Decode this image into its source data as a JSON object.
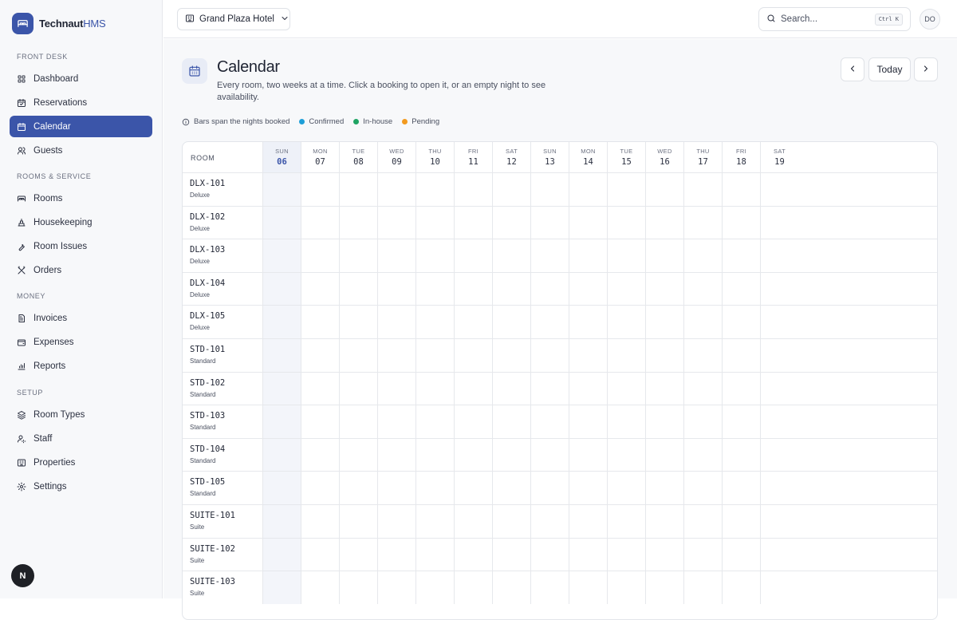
{
  "brand": {
    "name": "Technaut",
    "suffix": "HMS"
  },
  "sidebar": {
    "sections": [
      {
        "label": "FRONT DESK",
        "items": [
          {
            "label": "Dashboard",
            "icon": "grid-icon"
          },
          {
            "label": "Reservations",
            "icon": "calendar-check-icon"
          },
          {
            "label": "Calendar",
            "icon": "calendar-icon",
            "active": true
          },
          {
            "label": "Guests",
            "icon": "users-icon"
          }
        ]
      },
      {
        "label": "ROOMS & SERVICE",
        "items": [
          {
            "label": "Rooms",
            "icon": "bed-icon"
          },
          {
            "label": "Housekeeping",
            "icon": "brush-icon"
          },
          {
            "label": "Room Issues",
            "icon": "wrench-icon"
          },
          {
            "label": "Orders",
            "icon": "utensils-icon"
          }
        ]
      },
      {
        "label": "MONEY",
        "items": [
          {
            "label": "Invoices",
            "icon": "file-icon"
          },
          {
            "label": "Expenses",
            "icon": "wallet-icon"
          },
          {
            "label": "Reports",
            "icon": "bar-chart-icon"
          }
        ]
      },
      {
        "label": "SETUP",
        "items": [
          {
            "label": "Room Types",
            "icon": "layers-icon"
          },
          {
            "label": "Staff",
            "icon": "user-cog-icon"
          },
          {
            "label": "Properties",
            "icon": "building-icon"
          },
          {
            "label": "Settings",
            "icon": "gear-icon"
          }
        ]
      }
    ],
    "bottom_avatar": "N"
  },
  "topbar": {
    "hotel": "Grand Plaza Hotel",
    "search_placeholder": "Search...",
    "search_shortcut": "Ctrl K",
    "user_initials": "DO"
  },
  "page": {
    "title": "Calendar",
    "subtitle": "Every room, two weeks at a time. Click a booking to open it, or an empty night to see availability.",
    "today_label": "Today"
  },
  "legend": {
    "info": "Bars span the nights booked",
    "items": [
      {
        "label": "Confirmed",
        "color": "#1e9fd8"
      },
      {
        "label": "In-house",
        "color": "#1fa463"
      },
      {
        "label": "Pending",
        "color": "#f29a1f"
      }
    ]
  },
  "calendar": {
    "room_header": "ROOM",
    "days": [
      {
        "name": "SUN",
        "date": "06",
        "today": true
      },
      {
        "name": "MON",
        "date": "07"
      },
      {
        "name": "TUE",
        "date": "08"
      },
      {
        "name": "WED",
        "date": "09"
      },
      {
        "name": "THU",
        "date": "10"
      },
      {
        "name": "FRI",
        "date": "11"
      },
      {
        "name": "SAT",
        "date": "12"
      },
      {
        "name": "SUN",
        "date": "13"
      },
      {
        "name": "MON",
        "date": "14"
      },
      {
        "name": "TUE",
        "date": "15"
      },
      {
        "name": "WED",
        "date": "16"
      },
      {
        "name": "THU",
        "date": "17"
      },
      {
        "name": "FRI",
        "date": "18"
      },
      {
        "name": "SAT",
        "date": "19"
      }
    ],
    "rooms": [
      {
        "code": "DLX-101",
        "type": "Deluxe"
      },
      {
        "code": "DLX-102",
        "type": "Deluxe"
      },
      {
        "code": "DLX-103",
        "type": "Deluxe"
      },
      {
        "code": "DLX-104",
        "type": "Deluxe"
      },
      {
        "code": "DLX-105",
        "type": "Deluxe"
      },
      {
        "code": "STD-101",
        "type": "Standard"
      },
      {
        "code": "STD-102",
        "type": "Standard"
      },
      {
        "code": "STD-103",
        "type": "Standard"
      },
      {
        "code": "STD-104",
        "type": "Standard"
      },
      {
        "code": "STD-105",
        "type": "Standard"
      },
      {
        "code": "SUITE-101",
        "type": "Suite"
      },
      {
        "code": "SUITE-102",
        "type": "Suite"
      },
      {
        "code": "SUITE-103",
        "type": "Suite"
      }
    ]
  }
}
